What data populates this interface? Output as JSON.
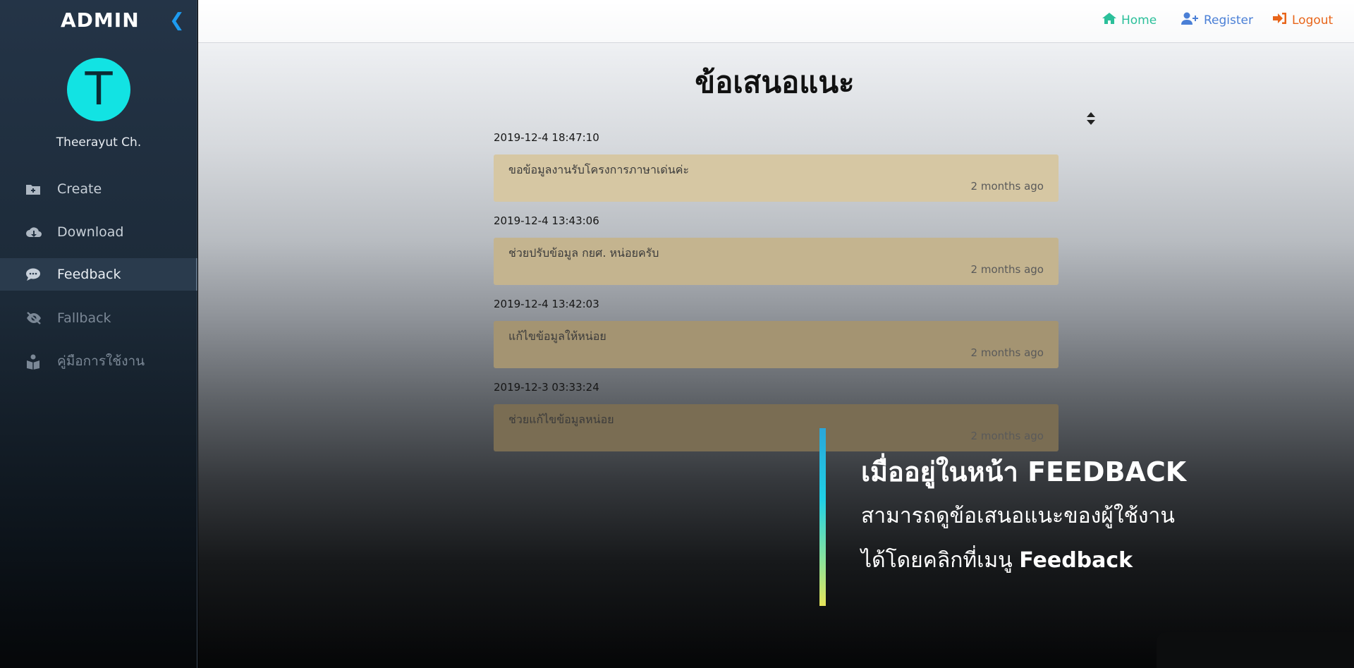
{
  "sidebar": {
    "brand": "ADMIN",
    "collapse_glyph": "❮",
    "avatar_letter": "T",
    "username": "Theerayut Ch.",
    "items": [
      {
        "label": "Create",
        "icon": "folder-plus-icon"
      },
      {
        "label": "Download",
        "icon": "cloud-download-icon"
      },
      {
        "label": "Feedback",
        "icon": "comment-icon",
        "active": true
      },
      {
        "label": "Fallback",
        "icon": "eye-slash-icon"
      },
      {
        "label": "คู่มือการใช้งาน",
        "icon": "book-reader-icon"
      }
    ]
  },
  "topnav": {
    "home": "Home",
    "register": "Register",
    "logout": "Logout"
  },
  "main": {
    "title": "ข้อเสนอแนะ",
    "feedback": [
      {
        "date": "2019-12-4 18:47:10",
        "message": "ขอข้อมูลงานรับโครงการภาษาเด่นค่ะ",
        "ago": "2 months ago"
      },
      {
        "date": "2019-12-4 13:43:06",
        "message": "ช่วยปรับข้อมูล กยศ. หน่อยครับ",
        "ago": "2 months ago"
      },
      {
        "date": "2019-12-4 13:42:03",
        "message": "แก้ไขข้อมูลให้หน่อย",
        "ago": "2 months ago"
      },
      {
        "date": "2019-12-3 03:33:24",
        "message": "ช่วยแก้ไขข้อมูลหน่อย",
        "ago": "2 months ago"
      }
    ]
  },
  "caption": {
    "title": "เมื่ออยู่ในหน้า FEEDBACK",
    "line1": "สามารถดูข้อเสนอแนะของผู้ใช้งาน",
    "line2_prefix": "ได้โดยคลิกที่เมนู ",
    "line2_bold": "Feedback"
  },
  "colors": {
    "home": "#2bbf9a",
    "register": "#4a7fd6",
    "logout": "#e8651a",
    "avatar": "#12e3e3",
    "card": "#d6c59d"
  }
}
